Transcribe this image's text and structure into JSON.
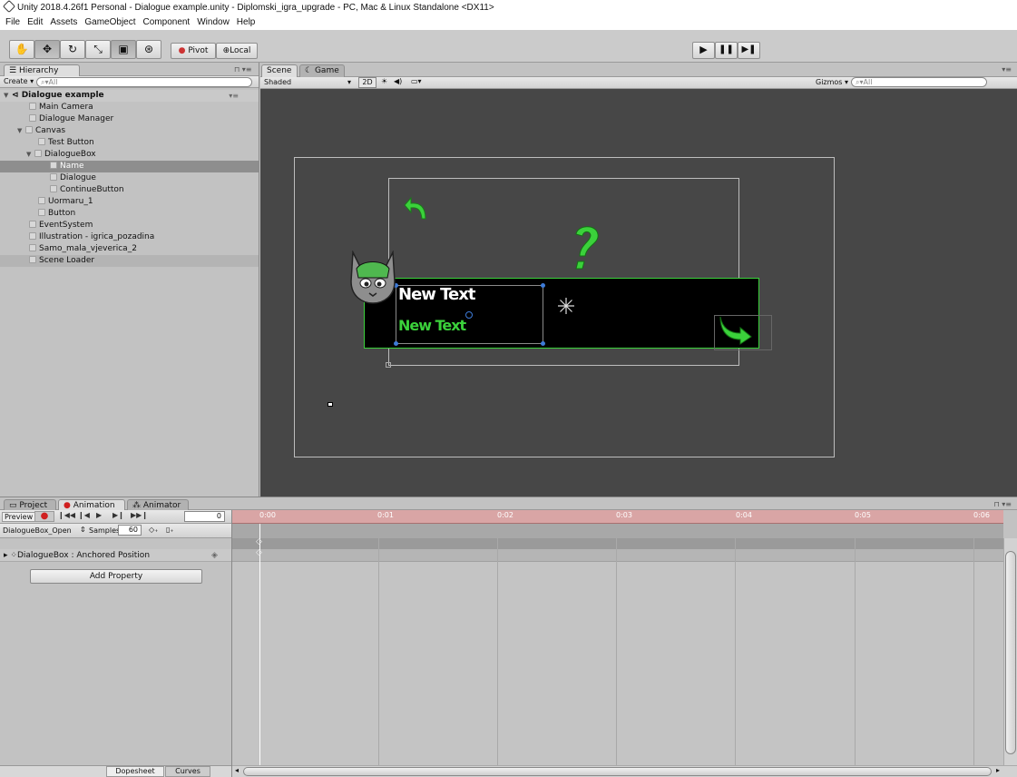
{
  "window": {
    "title": "Unity 2018.4.26f1 Personal - Dialogue example.unity - Diplomski_igra_upgrade - PC, Mac & Linux Standalone <DX11>"
  },
  "menu": [
    "File",
    "Edit",
    "Assets",
    "GameObject",
    "Component",
    "Window",
    "Help"
  ],
  "toolbar": {
    "pivot_label": "Pivot",
    "local_label": "Local",
    "tools": [
      "hand-icon",
      "move-icon",
      "rotate-icon",
      "scale-icon",
      "rect-icon",
      "transform-icon"
    ],
    "play_buttons": [
      "play-icon",
      "pause-icon",
      "step-icon"
    ]
  },
  "hierarchy": {
    "tab_label": "Hierarchy",
    "create_label": "Create",
    "search_placeholder": "All",
    "scene_name": "Dialogue example",
    "items": [
      {
        "label": "Main Camera",
        "depth": 1
      },
      {
        "label": "Dialogue Manager",
        "depth": 1
      },
      {
        "label": "Canvas",
        "depth": 1,
        "expanded": true
      },
      {
        "label": "Test Button",
        "depth": 2
      },
      {
        "label": "DialogueBox",
        "depth": 2,
        "expanded": true
      },
      {
        "label": "Name",
        "depth": 3,
        "selected": true
      },
      {
        "label": "Dialogue",
        "depth": 3
      },
      {
        "label": "ContinueButton",
        "depth": 3
      },
      {
        "label": "Uormaru_1",
        "depth": 2
      },
      {
        "label": "Button",
        "depth": 2
      },
      {
        "label": "EventSystem",
        "depth": 1
      },
      {
        "label": "Illustration - igrica_pozadina",
        "depth": 1
      },
      {
        "label": "Samo_mala_vjeverica_2",
        "depth": 1
      },
      {
        "label": "Scene Loader",
        "depth": 1,
        "highlight": true
      }
    ]
  },
  "scene_view": {
    "tab_scene": "Scene",
    "tab_game": "Game",
    "shading_mode": "Shaded",
    "mode_2d": "2D",
    "gizmos_label": "Gizmos",
    "search_placeholder": "All",
    "name_text": "New Text",
    "dialogue_text": "New Text"
  },
  "bottom": {
    "tab_project": "Project",
    "tab_animation": "Animation",
    "tab_animator": "Animator",
    "preview_label": "Preview",
    "frame_value": "0",
    "clip_name": "DialogueBox_Open",
    "samples_label": "Samples",
    "samples_value": "60",
    "property_label": "DialogueBox : Anchored Position",
    "add_property_label": "Add Property",
    "dopesheet_label": "Dopesheet",
    "curves_label": "Curves",
    "timeline_marks": [
      "0:00",
      "0:01",
      "0:02",
      "0:03",
      "0:04",
      "0:05",
      "0:06"
    ]
  },
  "colors": {
    "scene_bg": "#474747",
    "selection_green": "#3bd13b",
    "timeline_ruler": "#d9a5a5",
    "record_red": "#d02020"
  }
}
